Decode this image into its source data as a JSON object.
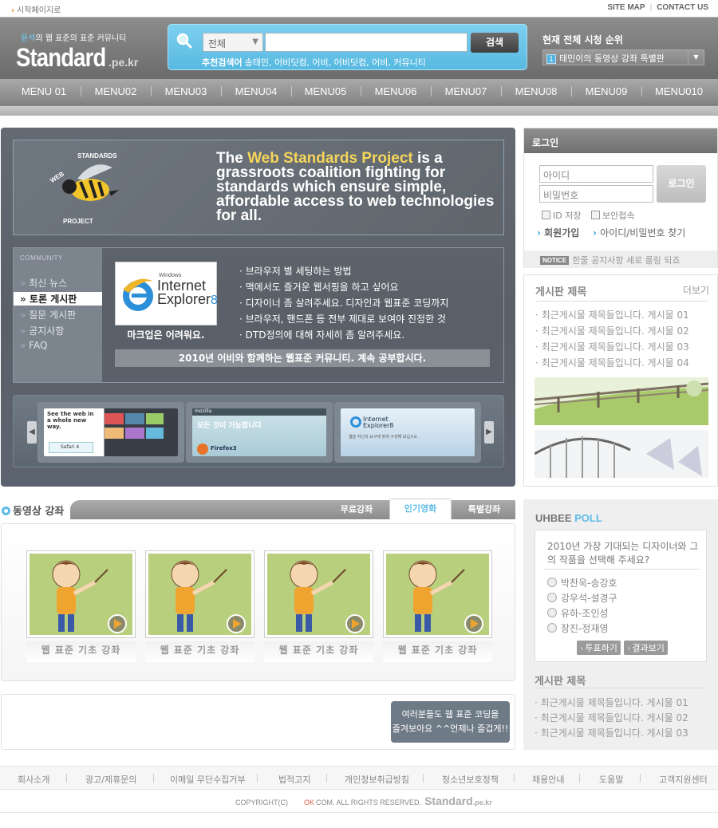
{
  "topbar": {
    "home_link": "시작페이지로",
    "sitemap": "SITE MAP",
    "contact": "CONTACT US"
  },
  "header": {
    "logo_tag_hl": "윤석",
    "logo_tag": "의 웹 표준의 표준 커뮤니티",
    "logo_main": "Standard",
    "logo_sub": ".pe.kr",
    "search": {
      "select_value": "전체",
      "button": "검색",
      "recommend_label": "추천검색어",
      "recommend_terms": "송태민, 어비딧컴, 어비, 어비딧컴, 어비, 커뮤니티"
    },
    "ranking": {
      "title": "현재 전체 시청 순위",
      "number": "1",
      "item": "태민이의 동영상 강좌 특별판"
    }
  },
  "nav": [
    "MENU 01",
    "MENU02",
    "MENU03",
    "MENU04",
    "MENU05",
    "MENU06",
    "MENU07",
    "MENU08",
    "MENU09",
    "MENU010"
  ],
  "hero": {
    "banner_hl": "Web Standards Project",
    "banner_pre": "The ",
    "banner_post": " is a grassroots coalition fighting for standards which ensure simple, affordable access to web technologies for all.",
    "community": {
      "label": "COMMUNITY",
      "menu": [
        "최신 뉴스",
        "토론 게시판",
        "질문 게시판",
        "공지사항",
        "FAQ"
      ],
      "ie_small": "Windows",
      "ie_line1": "Internet",
      "ie_line2": "Explorer",
      "ie_ver": "8",
      "ie_caption": "마크업은 어려워요.",
      "lines": [
        "브라우저 별 세팅하는 방법",
        "맥에서도 즐거운 웹서핑을 하고 싶어요",
        "디자이너 좀 살려주세요. 디자인과 웹표준 코딩까지",
        "브라우저, 핸드폰 등 전부 제대로 보여야 진정한 것",
        "DTD정의에 대해 자세히 좀 알려주세요."
      ],
      "bar": "2010년 어비와 함께하는 웹표준 커뮤니티. 계속 공부합시다."
    },
    "thumbs": {
      "t1_text": "See the web in a whole new way.",
      "t1_sub": "Safari 4",
      "t2_header": "mozilla",
      "t2_text": "모든 것이 가능합니다",
      "t2_sub": "Firefox3",
      "t3_text": "Internet Explorer8",
      "t3_sub": "웹을 자신의 요구에 맞게 구성해 보십시오"
    }
  },
  "login": {
    "title": "로그인",
    "id_placeholder": "아이디",
    "pw_placeholder": "비밀번호",
    "button": "로그인",
    "save_id": "ID 저장",
    "secure": "보안접속",
    "join": "회원가입",
    "find": "아이디/비밀번호 찾기",
    "notice_badge": "NOTICE",
    "notice_text": "한줄 공지사항 세로 롤링 되죠"
  },
  "board1": {
    "title": "게시판 제목",
    "more": "더보기",
    "items": [
      "최근게시물 제목들입니다. 게시물 01",
      "최근게시물 제목들입니다. 게시물 02",
      "최근게시물 제목들입니다. 게시물 03",
      "최근게시물 제목들입니다. 게시물 04"
    ]
  },
  "poll": {
    "title_a": "UHBEE ",
    "title_b": "POLL",
    "question": "2010년 가장 기대되는 디자이너와 그의 작품을 선택해 주세요?",
    "options": [
      "박찬욱-송강호",
      "강우석-설경구",
      "유하-조인성",
      "장진-정재영"
    ],
    "vote": "투표하기",
    "result": "결과보기"
  },
  "board2": {
    "title": "게시판 제목",
    "items": [
      "최근게시물 제목들입니다. 게시물 01",
      "최근게시물 제목들입니다. 게시물 02",
      "최근게시물 제목들입니다. 게시물 03"
    ]
  },
  "video": {
    "title": "동영상 강좌",
    "tabs": [
      "무료강좌",
      "인기영화",
      "특별강좌"
    ],
    "items": [
      "웹 표준 기초 강좌",
      "웹 표준 기초 강좌",
      "웹 표준 기초 강좌",
      "웹 표준 기초 강좌"
    ]
  },
  "promo": {
    "line1": "여러분들도 웹 표준 코딩을",
    "line2": "즐겨보아요 ^^언제나 즐겁게!!"
  },
  "footer": {
    "links": [
      "회사소개",
      "광고/제휴문의",
      "이메일 무단수집거부",
      "법적고지",
      "개인정보취급방침",
      "청소년보호정책",
      "채용안내",
      "도움말",
      "고객지원센터"
    ],
    "copy_pre": "COPYRIGHT(C)",
    "copy_ok": "OK",
    "copy_post": "COM.  ALL RIGHTS RESERVED.",
    "copy_logo_main": "Standard",
    "copy_logo_sub": ".pe.kr"
  },
  "colors": {
    "accent": "#5dbce8",
    "header_gray": "#7a7a7a",
    "hero_bg": "#5f666e",
    "banner_highlight": "#f5d55a"
  }
}
